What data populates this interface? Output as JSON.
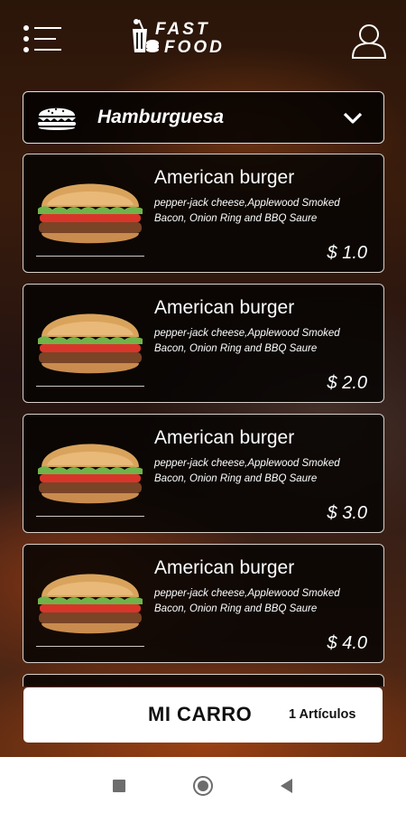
{
  "header": {
    "menu_icon": "hamburger-menu-icon",
    "logo_line1": "FAST",
    "logo_line2": "FOOD",
    "user_icon": "user-icon"
  },
  "category": {
    "icon": "burger-icon",
    "selected": "Hamburguesa",
    "dropdown_icon": "chevron-down-icon"
  },
  "products": [
    {
      "name": "American burger",
      "description": "pepper-jack cheese,Applewood Smoked Bacon, Onion Ring and BBQ Saure",
      "price": "$ 1.0"
    },
    {
      "name": "American burger",
      "description": "pepper-jack cheese,Applewood Smoked Bacon, Onion Ring and BBQ Saure",
      "price": "$ 2.0"
    },
    {
      "name": "American burger",
      "description": "pepper-jack cheese,Applewood Smoked Bacon, Onion Ring and BBQ Saure",
      "price": "$ 3.0"
    },
    {
      "name": "American burger",
      "description": "pepper-jack cheese,Applewood Smoked Bacon, Onion Ring and BBQ Saure",
      "price": "$ 4.0"
    }
  ],
  "cart": {
    "title": "MI CARRO",
    "count": "1 Artículos"
  },
  "navbar": {
    "recents_icon": "recents-square-icon",
    "home_icon": "home-circle-icon",
    "back_icon": "back-triangle-icon"
  },
  "colors": {
    "background": "#2a1509",
    "card_background": "#050302",
    "border": "#d8d0c8",
    "text": "#ffffff",
    "cart_background": "#ffffff"
  }
}
